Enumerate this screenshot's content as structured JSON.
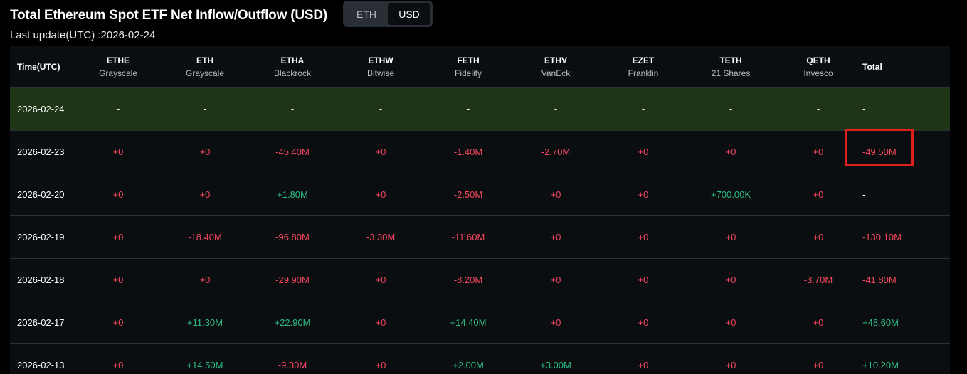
{
  "page": {
    "title": "Total Ethereum Spot ETF Net Inflow/Outflow (USD)",
    "last_update": "Last update(UTC) :2026-02-24",
    "toggle": {
      "options": [
        "ETH",
        "USD"
      ],
      "selected": "USD"
    }
  },
  "colors": {
    "negative": "#f6465d",
    "positive": "#2ebd85",
    "highlight_row": "#1f3516",
    "annotation_box": "#e0201c"
  },
  "table": {
    "time_header": "Time(UTC)",
    "total_header": "Total",
    "columns": [
      {
        "code": "ETHE",
        "issuer": "Grayscale"
      },
      {
        "code": "ETH",
        "issuer": "Grayscale"
      },
      {
        "code": "ETHA",
        "issuer": "Blackrock"
      },
      {
        "code": "ETHW",
        "issuer": "Bitwise"
      },
      {
        "code": "FETH",
        "issuer": "Fidelity"
      },
      {
        "code": "ETHV",
        "issuer": "VanEck"
      },
      {
        "code": "EZET",
        "issuer": "Franklin"
      },
      {
        "code": "TETH",
        "issuer": "21 Shares"
      },
      {
        "code": "QETH",
        "issuer": "Invesco"
      }
    ],
    "rows": [
      {
        "date": "2026-02-24",
        "values": [
          "-",
          "-",
          "-",
          "-",
          "-",
          "-",
          "-",
          "-",
          "-"
        ],
        "total": "-"
      },
      {
        "date": "2026-02-23",
        "values": [
          "+0",
          "+0",
          "-45.40M",
          "+0",
          "-1.40M",
          "-2.70M",
          "+0",
          "+0",
          "+0"
        ],
        "total": "-49.50M"
      },
      {
        "date": "2026-02-20",
        "values": [
          "+0",
          "+0",
          "+1.80M",
          "+0",
          "-2.50M",
          "+0",
          "+0",
          "+700.00K",
          "+0"
        ],
        "total": "-"
      },
      {
        "date": "2026-02-19",
        "values": [
          "+0",
          "-18.40M",
          "-96.80M",
          "-3.30M",
          "-11.60M",
          "+0",
          "+0",
          "+0",
          "+0"
        ],
        "total": "-130.10M"
      },
      {
        "date": "2026-02-18",
        "values": [
          "+0",
          "+0",
          "-29.90M",
          "+0",
          "-8.20M",
          "+0",
          "+0",
          "+0",
          "-3.70M"
        ],
        "total": "-41.80M"
      },
      {
        "date": "2026-02-17",
        "values": [
          "+0",
          "+11.30M",
          "+22.90M",
          "+0",
          "+14.40M",
          "+0",
          "+0",
          "+0",
          "+0"
        ],
        "total": "+48.60M"
      },
      {
        "date": "2026-02-13",
        "values": [
          "+0",
          "+14.50M",
          "-9.30M",
          "+0",
          "+2.00M",
          "+3.00M",
          "+0",
          "+0",
          "+0"
        ],
        "total": "+10.20M"
      }
    ]
  }
}
